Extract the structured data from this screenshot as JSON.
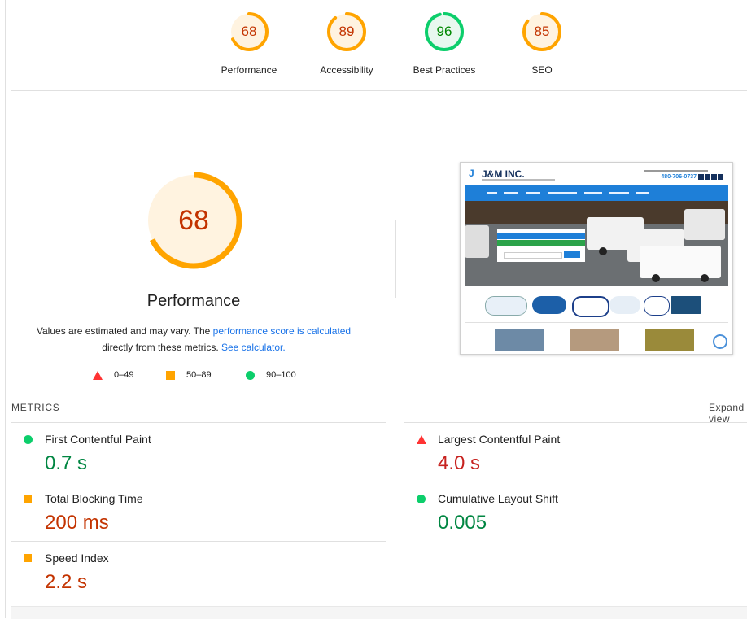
{
  "scores": [
    {
      "label": "Performance",
      "value": 68,
      "color": "#ffa400",
      "text_color": "#c33300",
      "bg": "#fff3e0"
    },
    {
      "label": "Accessibility",
      "value": 89,
      "color": "#ffa400",
      "text_color": "#c33300",
      "bg": "#fff3e0"
    },
    {
      "label": "Best Practices",
      "value": 96,
      "color": "#0cce6b",
      "text_color": "#008800",
      "bg": "#e8f8ef"
    },
    {
      "label": "SEO",
      "value": 85,
      "color": "#ffa400",
      "text_color": "#c33300",
      "bg": "#fff3e0"
    }
  ],
  "performance": {
    "score": 68,
    "title": "Performance",
    "desc_prefix": "Values are estimated and may vary. The ",
    "desc_link": "performance score is calculated",
    "desc_mid": "directly from these metrics. ",
    "desc_link2": "See calculator."
  },
  "legend": {
    "fail": "0–49",
    "average": "50–89",
    "pass": "90–100"
  },
  "screenshot": {
    "logo": "J&M INC.",
    "phone": "480-706-0737"
  },
  "metrics": {
    "header": "METRICS",
    "expand": "Expand view",
    "items": [
      {
        "name": "First Contentful Paint",
        "value": "0.7 s",
        "status": "pass"
      },
      {
        "name": "Largest Contentful Paint",
        "value": "4.0 s",
        "status": "fail"
      },
      {
        "name": "Total Blocking Time",
        "value": "200 ms",
        "status": "average"
      },
      {
        "name": "Cumulative Layout Shift",
        "value": "0.005",
        "status": "pass"
      },
      {
        "name": "Speed Index",
        "value": "2.2 s",
        "status": "average"
      }
    ]
  }
}
